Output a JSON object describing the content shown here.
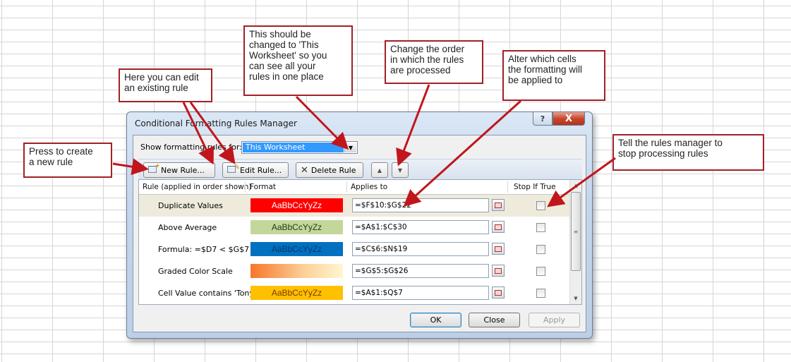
{
  "callouts": {
    "scope": "This should be\nchanged to 'This\nWorksheet' so you\ncan see all your\nrules in one place",
    "order": "Change the order\nin which the rules\nare processed",
    "edit": "Here you can edit\nan existing rule",
    "alter": "Alter which cells\nthe formatting will\nbe applied to",
    "new_rule": "Press to create\na new rule",
    "stop": "Tell the rules manager to\nstop processing rules"
  },
  "dialog": {
    "title": "Conditional Formatting Rules Manager",
    "help_glyph": "?",
    "close_glyph": "X",
    "show_label": "Show formatting rules for:",
    "show_value": "This Worksheet",
    "toolbar": {
      "new_rule": "New Rule...",
      "edit_rule": "Edit Rule...",
      "delete_rule": "Delete Rule",
      "move_up_glyph": "▲",
      "move_down_glyph": "▼"
    },
    "columns": [
      "Rule (applied in order shown)",
      "Format",
      "Applies to",
      "Stop If True"
    ],
    "rules": [
      {
        "name": "Duplicate Values",
        "format_preview": "AaBbCcYyZz",
        "applies_to": "=$F$10:$G$22",
        "stop_if_true": false,
        "fill": "#ff0000",
        "text_color": "#ffffff"
      },
      {
        "name": "Above Average",
        "format_preview": "AaBbCcYyZz",
        "applies_to": "=$A$1:$C$30",
        "stop_if_true": false,
        "fill": "#c4d79b",
        "text_color": "#1f3a0f"
      },
      {
        "name": "Formula: =$D7 < $G$7",
        "format_preview": "AaBbCcYyZz",
        "applies_to": "=$C$6:$N$19",
        "stop_if_true": false,
        "fill": "#0070c0",
        "text_color": "#003a6e"
      },
      {
        "name": "Graded Color Scale",
        "format_preview": "",
        "applies_to": "=$G$5:$G$26",
        "stop_if_true": false,
        "fill": "linear-gradient(to right,#f8752a,#fcd39c 60%,#fff6cf)",
        "text_color": "#000000"
      },
      {
        "name": "Cell Value contains 'Tony'",
        "format_preview": "AaBbCcYyZz",
        "applies_to": "=$A$1:$Q$7",
        "stop_if_true": false,
        "fill": "#ffc000",
        "text_color": "#7a3a00"
      }
    ],
    "buttons": {
      "ok": "OK",
      "close": "Close",
      "apply": "Apply"
    }
  },
  "colors": {
    "callout_border": "#a22026",
    "arrow": "#c0161c"
  }
}
